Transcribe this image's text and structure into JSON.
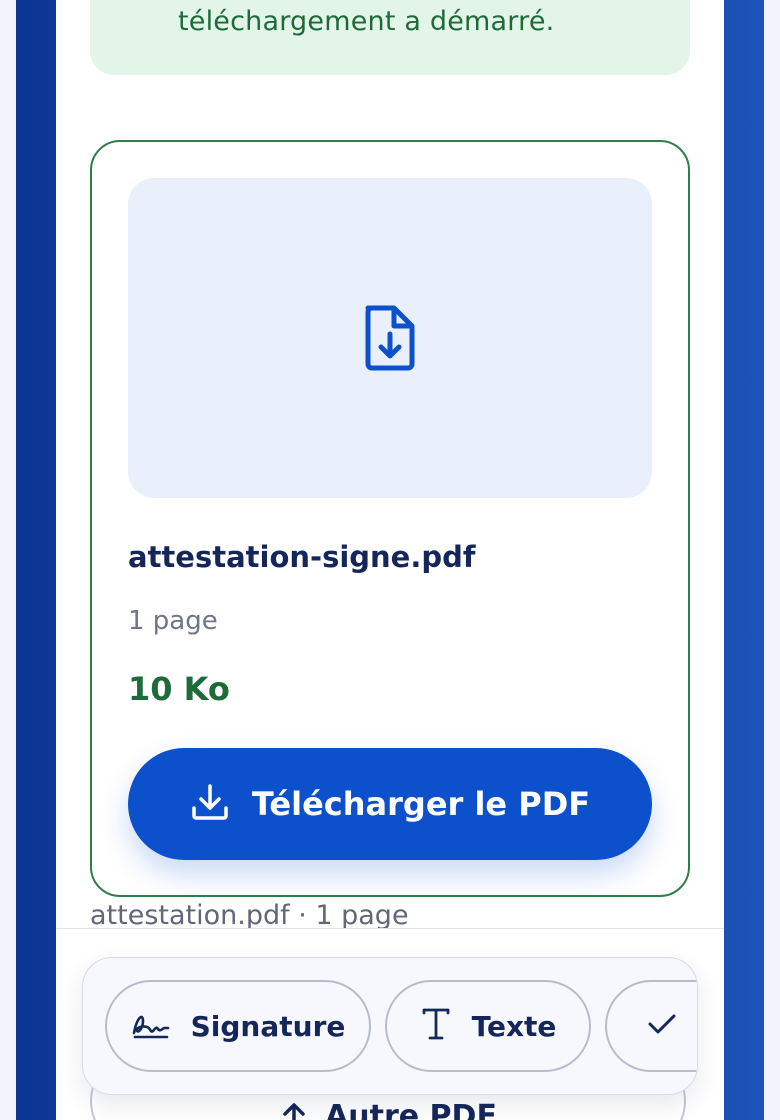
{
  "banner": {
    "text": "téléchargement a démarré."
  },
  "result_card": {
    "filename": "attestation-signe.pdf",
    "pages": "1 page",
    "size": "10 Ko",
    "download_label": "Télécharger le PDF"
  },
  "source_info": "attestation.pdf · 1 page",
  "toolbar": {
    "tools": [
      {
        "label": "Signature",
        "icon": "signature-icon"
      },
      {
        "label": "Texte",
        "icon": "text-icon"
      },
      {
        "label": "",
        "icon": "check-icon"
      }
    ]
  },
  "secondary_button": {
    "label": "Autre PDF",
    "icon": "upload-arrow-icon"
  },
  "colors": {
    "primary": "#0d50cc",
    "success": "#1e6b3a",
    "success_bg": "#e3f4e8",
    "ink": "#15275a"
  }
}
